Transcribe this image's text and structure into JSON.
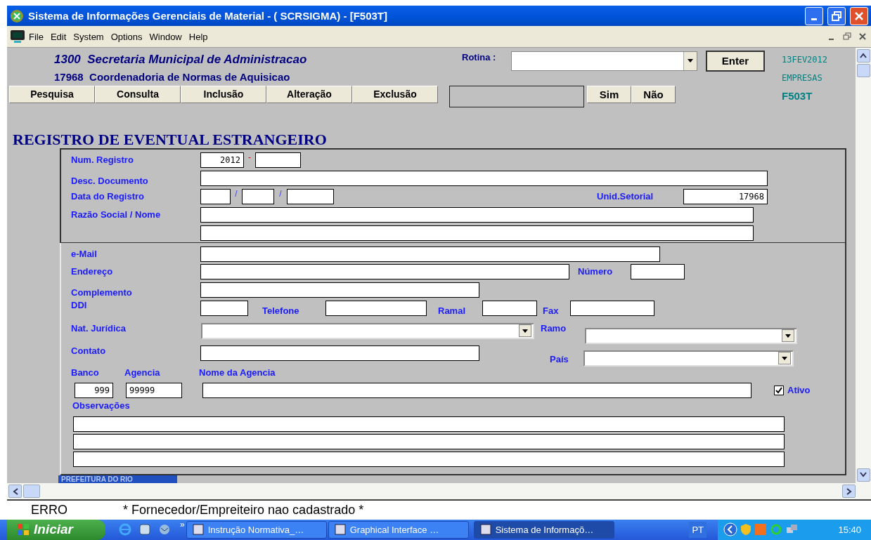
{
  "window": {
    "title": "Sistema de Informações Gerenciais de Material - ( SCRSIGMA) - [F503T]"
  },
  "menu": [
    "File",
    "Edit",
    "System",
    "Options",
    "Window",
    "Help"
  ],
  "header": {
    "org_lines": [
      {
        "code": "1300",
        "name": "Secretaria Municipal de Administracao"
      },
      {
        "code": "17968",
        "name": "Coordenadoria de Normas de Aquisicao"
      }
    ],
    "rotina_label": "Rotina :",
    "enter": "Enter",
    "info": [
      "13FEV2012",
      "EMPRESAS",
      "F503T"
    ]
  },
  "actions": [
    "Pesquisa",
    "Consulta",
    "Inclusão",
    "Alteração",
    "Exclusão"
  ],
  "confirm": [
    "Sim",
    "Não"
  ],
  "form": {
    "title": "REGISTRO DE EVENTUAL ESTRANGEIRO",
    "num_registro": {
      "label": "Num. Registro",
      "year": "2012",
      "separator": "-"
    },
    "desc_documento": {
      "label": "Desc. Documento"
    },
    "data_registro": {
      "label": "Data do Registro",
      "separators": [
        "/",
        "/"
      ]
    },
    "unid_setorial": {
      "label": "Unid.Setorial",
      "value": "17968"
    },
    "razao_social": {
      "label": "Razão Social / Nome"
    },
    "email": {
      "label": "e-Mail"
    },
    "endereco": {
      "label": "Endereço"
    },
    "numero": {
      "label": "Número"
    },
    "complemento": {
      "label": "Complemento"
    },
    "ddi": {
      "label": "DDI"
    },
    "telefone": {
      "label": "Telefone"
    },
    "ramal": {
      "label": "Ramal"
    },
    "fax": {
      "label": "Fax"
    },
    "nat_juridica": {
      "label": "Nat. Jurídica"
    },
    "ramo": {
      "label": "Ramo"
    },
    "contato": {
      "label": "Contato"
    },
    "pais": {
      "label": "País"
    },
    "banco": {
      "label": "Banco",
      "value": "999"
    },
    "agencia": {
      "label": "Agencia",
      "value": "99999"
    },
    "nome_agencia": {
      "label": "Nome da Agencia"
    },
    "ativo": {
      "label": "Ativo",
      "checked": true
    },
    "observacoes": {
      "label": "Observações"
    },
    "footer_tab": "PREFEITURA DO RIO"
  },
  "status": {
    "label": "ERRO",
    "message": "* Fornecedor/Empreiteiro nao cadastrado *"
  },
  "taskbar": {
    "start": "Iniciar",
    "more": "»",
    "tasks": [
      {
        "label": "Instrução Normativa_…",
        "selected": false
      },
      {
        "label": "Graphical Interface …",
        "selected": false
      },
      {
        "label": "Sistema de Informaçõ…",
        "selected": true
      }
    ],
    "language": "PT",
    "clock": "15:40"
  }
}
